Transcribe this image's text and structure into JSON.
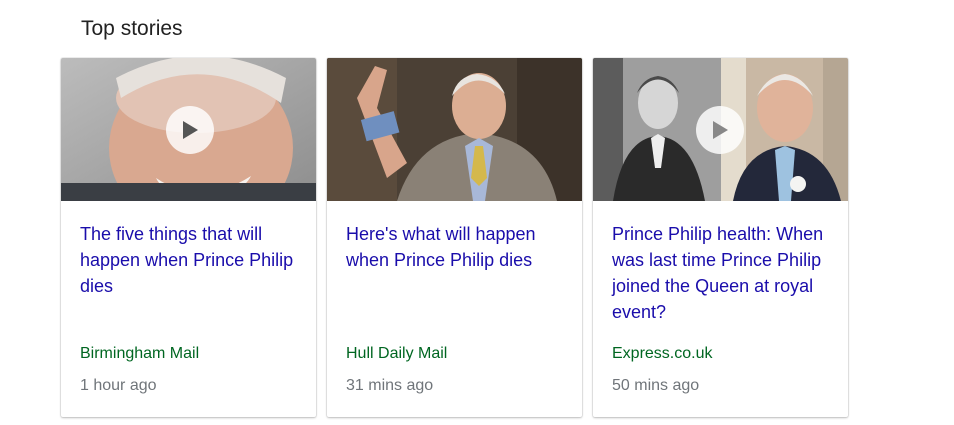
{
  "section": {
    "title": "Top stories"
  },
  "stories": [
    {
      "headline": "The five things that will happen when Prince Philip dies",
      "source": "Birmingham Mail",
      "time": "1 hour ago",
      "has_video": true
    },
    {
      "headline": "Here's what will happen when Prince Philip dies",
      "source": "Hull Daily Mail",
      "time": "31 mins ago",
      "has_video": false
    },
    {
      "headline": "Prince Philip health: When was last time Prince Philip joined the Queen at royal event?",
      "source": "Express.co.uk",
      "time": "50 mins ago",
      "has_video": true
    }
  ],
  "colors": {
    "headline": "#1a0dab",
    "source": "#006621",
    "time": "#70757a"
  },
  "icons": {
    "play": "play-icon"
  }
}
